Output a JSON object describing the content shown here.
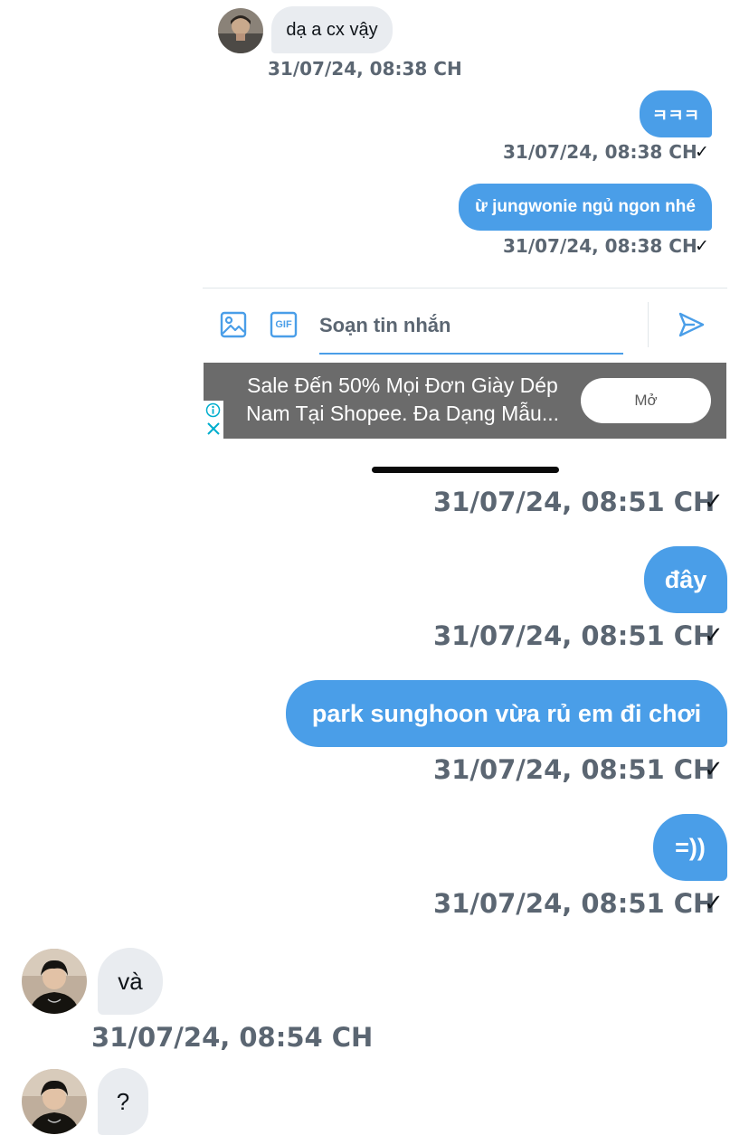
{
  "thread_top": {
    "incoming_1": {
      "text": "dạ a cx vậy",
      "time": "31/07/24, 08:38 CH"
    },
    "outgoing_1": {
      "text": "ㅋㅋㅋ",
      "time": "31/07/24, 08:38 CH"
    },
    "outgoing_2": {
      "text": "ừ jungwonie ngủ ngon nhé",
      "time": "31/07/24, 08:38 CH"
    },
    "read_check": "✓"
  },
  "composer": {
    "placeholder": "Soạn tin nhắn",
    "gif_label": "GIF",
    "icons": [
      "image-icon",
      "gif-icon",
      "send-icon"
    ]
  },
  "ad": {
    "line_1": "Sale Đến 50% Mọi Đơn Giày Dép",
    "line_2": "Nam Tại Shopee. Đa Dạng Mẫu...",
    "button_label": "Mở",
    "icons": [
      "info-icon",
      "close-icon"
    ]
  },
  "thread_bottom": {
    "first_time": "31/07/24, 08:51 CH",
    "outgoing_1": {
      "text": "đây",
      "time": "31/07/24, 08:51 CH"
    },
    "outgoing_2": {
      "text": "park sunghoon vừa rủ em đi chơi",
      "time": "31/07/24, 08:51 CH"
    },
    "outgoing_3": {
      "text": "=))",
      "time": "31/07/24, 08:51 CH"
    },
    "incoming_1": {
      "text": "và",
      "time": "31/07/24, 08:54 CH"
    },
    "incoming_2": {
      "text": "?"
    },
    "read_check": "✓"
  },
  "colors": {
    "accent": "#4a9ee8",
    "incoming_bubble": "#e9ecf0",
    "timestamp": "#5b6672",
    "ad_background": "#6b6b6b"
  }
}
